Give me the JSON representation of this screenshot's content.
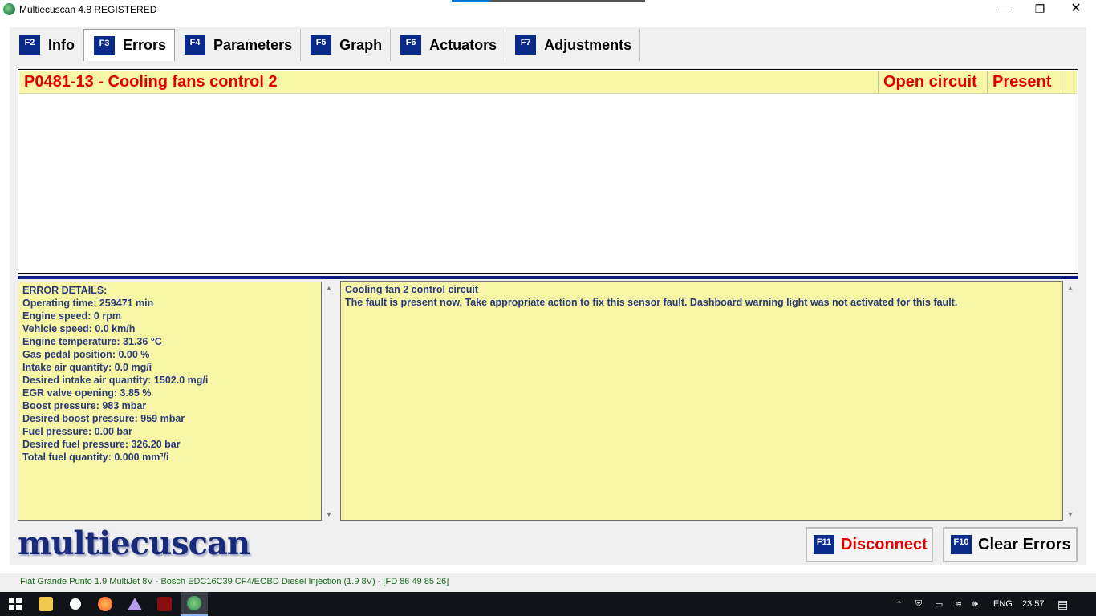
{
  "window": {
    "title": "Multiecuscan 4.8 REGISTERED",
    "minimize": "—",
    "maximize": "❐",
    "close": "✕"
  },
  "tabs": [
    {
      "fkey": "F2",
      "label": "Info"
    },
    {
      "fkey": "F3",
      "label": "Errors"
    },
    {
      "fkey": "F4",
      "label": "Parameters"
    },
    {
      "fkey": "F5",
      "label": "Graph"
    },
    {
      "fkey": "F6",
      "label": "Actuators"
    },
    {
      "fkey": "F7",
      "label": "Adjustments"
    }
  ],
  "errors": [
    {
      "code": "P0481-13 - Cooling fans control 2",
      "type": "Open circuit",
      "status": "Present"
    }
  ],
  "details": {
    "lines": [
      "ERROR DETAILS:",
      "Operating time: 259471 min",
      "Engine speed: 0 rpm",
      "Vehicle speed: 0.0 km/h",
      "Engine temperature: 31.36 °C",
      "Gas pedal position: 0.00 %",
      "Intake air quantity: 0.0 mg/i",
      "Desired intake air quantity: 1502.0 mg/i",
      "EGR valve opening: 3.85 %",
      "Boost pressure: 983 mbar",
      "Desired boost pressure: 959 mbar",
      "Fuel pressure: 0.00 bar",
      "Desired fuel pressure: 326.20 bar",
      "Total fuel quantity: 0.000 mm³/i"
    ]
  },
  "description": {
    "title": "Cooling fan 2 control circuit",
    "text": "The fault is present now. Take appropriate action to fix this sensor fault. Dashboard warning light was not activated for this fault."
  },
  "logo": "multiecuscan",
  "buttons": {
    "disconnect": {
      "fkey": "F11",
      "label": "Disconnect"
    },
    "clear": {
      "fkey": "F10",
      "label": "Clear Errors"
    }
  },
  "statusbar": "Fiat Grande Punto 1.9 MultiJet 8V - Bosch EDC16C39 CF4/EOBD Diesel Injection (1.9 8V) - [FD 86 49 85 26]",
  "taskbar": {
    "language": "ENG",
    "time": "23:57"
  }
}
